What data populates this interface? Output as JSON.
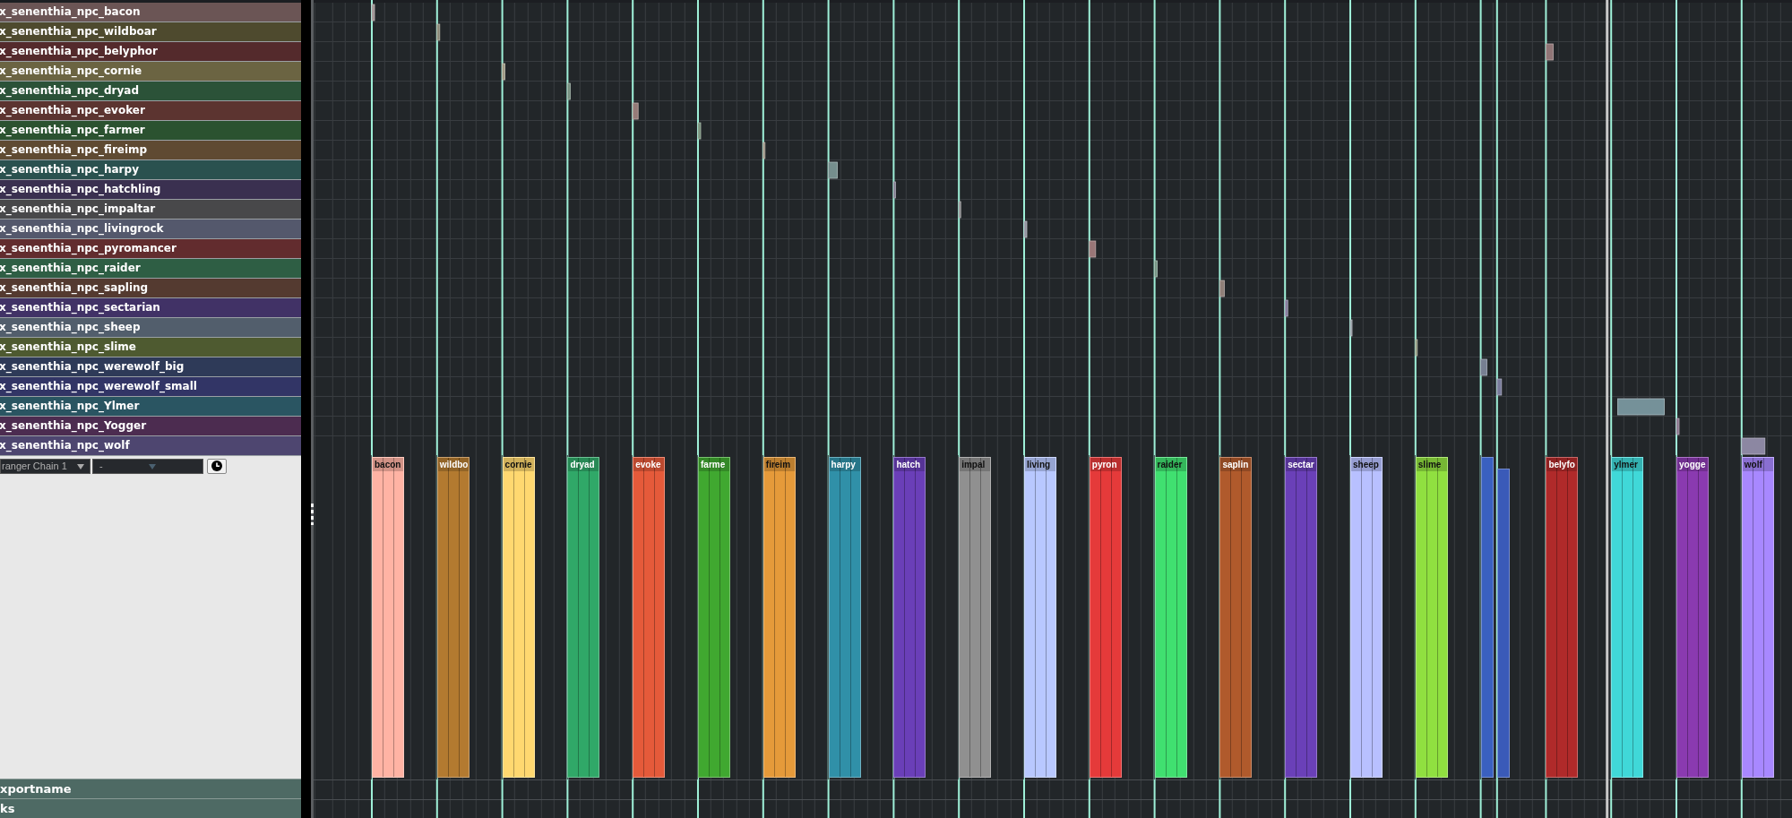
{
  "tracks": [
    {
      "name": "x_senenthia_npc_bacon",
      "color": "#6b5555"
    },
    {
      "name": "x_senenthia_npc_wildboar",
      "color": "#4e4a2e"
    },
    {
      "name": "x_senenthia_npc_belyphor",
      "color": "#542a2c"
    },
    {
      "name": "x_senenthia_npc_cornie",
      "color": "#6b6442"
    },
    {
      "name": "x_senenthia_npc_dryad",
      "color": "#2b5238"
    },
    {
      "name": "x_senenthia_npc_evoker",
      "color": "#5c3430"
    },
    {
      "name": "x_senenthia_npc_farmer",
      "color": "#2b5230"
    },
    {
      "name": "x_senenthia_npc_fireimp",
      "color": "#5f4a32"
    },
    {
      "name": "x_senenthia_npc_harpy",
      "color": "#2a514f"
    },
    {
      "name": "x_senenthia_npc_hatchling",
      "color": "#3a3050"
    },
    {
      "name": "x_senenthia_npc_impaltar",
      "color": "#48484a"
    },
    {
      "name": "x_senenthia_npc_livingrock",
      "color": "#54586c"
    },
    {
      "name": "x_senenthia_npc_pyromancer",
      "color": "#622c2e"
    },
    {
      "name": "x_senenthia_npc_raider",
      "color": "#2e5e44"
    },
    {
      "name": "x_senenthia_npc_sapling",
      "color": "#543a30"
    },
    {
      "name": "x_senenthia_npc_sectarian",
      "color": "#413266"
    },
    {
      "name": "x_senenthia_npc_sheep",
      "color": "#525e6c"
    },
    {
      "name": "x_senenthia_npc_slime",
      "color": "#4e5a30"
    },
    {
      "name": "x_senenthia_npc_werewolf_big",
      "color": "#2e3a58"
    },
    {
      "name": "x_senenthia_npc_werewolf_small",
      "color": "#323566"
    },
    {
      "name": "x_senenthia_npc_Ylmer",
      "color": "#2a5562"
    },
    {
      "name": "x_senenthia_npc_Yogger",
      "color": "#4c2c50"
    },
    {
      "name": "x_senenthia_npc_wolf",
      "color": "#4e4670"
    }
  ],
  "arranger": {
    "chain": "ranger Chain 1",
    "mode": "-",
    "clips": [
      {
        "label": "bacon",
        "color": "#ffb3a4"
      },
      {
        "label": "wildbo",
        "color": "#b37a30"
      },
      {
        "label": "cornie",
        "color": "#ffd870"
      },
      {
        "label": "dryad",
        "color": "#30a868"
      },
      {
        "label": "evoke",
        "color": "#e55a3a"
      },
      {
        "label": "farme",
        "color": "#40a830"
      },
      {
        "label": "fireim",
        "color": "#e59a3a"
      },
      {
        "label": "harpy",
        "color": "#3090a8"
      },
      {
        "label": "hatch",
        "color": "#6a3fb8"
      },
      {
        "label": "impal",
        "color": "#909090"
      },
      {
        "label": "living",
        "color": "#b8c8ff"
      },
      {
        "label": "pyron",
        "color": "#e53a3a"
      },
      {
        "label": "raider",
        "color": "#40e070"
      },
      {
        "label": "saplin",
        "color": "#b05a2c"
      },
      {
        "label": "sectar",
        "color": "#6a40b8"
      },
      {
        "label": "sheep",
        "color": "#b8c0ff"
      },
      {
        "label": "slime",
        "color": "#90e040"
      },
      {
        "color": "#3a60c0"
      },
      {
        "color": "#3a5ab8"
      },
      {
        "label": "belyfo",
        "color": "#b02a2a"
      },
      {
        "label": "ylmer",
        "color": "#40d8d8"
      },
      {
        "label": "yogge",
        "color": "#8a3ab0"
      },
      {
        "label": "wolf",
        "color": "#a888ff"
      }
    ]
  },
  "bottom_tracks": [
    {
      "name": "xportname"
    },
    {
      "name": "ks"
    }
  ]
}
